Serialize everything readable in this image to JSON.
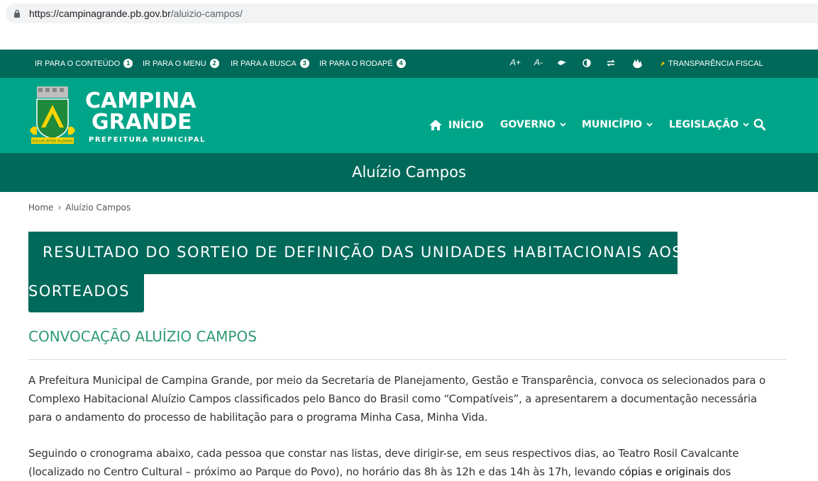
{
  "browser": {
    "url_host": "https://campinagrande.pb.gov.br",
    "url_path": "/aluizio-campos/"
  },
  "accessibility_bar": {
    "skip_links": [
      {
        "label": "IR PARA O CONTEÚDO",
        "number": "1"
      },
      {
        "label": "IR PARA O MENU",
        "number": "2"
      },
      {
        "label": "IR PARA A BUSCA",
        "number": "3"
      },
      {
        "label": "IR PARA O RODAPÉ",
        "number": "4"
      }
    ],
    "font_increase": "A+",
    "font_decrease": "A-",
    "transparency": "TRANSPARÊNCIA FISCAL"
  },
  "brand": {
    "line1": "CAMPINA",
    "line2": "GRANDE",
    "subtitle": "PREFEITURA MUNICIPAL"
  },
  "nav": {
    "home": "INÍCIO",
    "governo": "GOVERNO",
    "municipio": "MUNICÍPIO",
    "legislacao": "LEGISLAÇÃO"
  },
  "page": {
    "title": "Aluízio Campos",
    "breadcrumb_home": "Home",
    "breadcrumb_sep": "›",
    "breadcrumb_current": "Aluízio Campos",
    "banner_line1": "RESULTADO DO SORTEIO DE DEFINIÇÃO DAS UNIDADES HABITACIONAIS AOS",
    "banner_line2": "SORTEADOS",
    "subheading": "CONVOCAÇÃO ALUÍZIO CAMPOS",
    "paragraph1": [
      "A Prefeitura Municipal de Campina Grande, por meio da Secretaria de Planejamento, Gestão e Transparência, convoca os selecionados para o",
      "Complexo Habitacional Aluízio Campos classificados pelo Banco do Brasil como “Compatíveis”, a apresentarem a documentação necessária",
      "para o andamento do processo de habilitação para o programa Minha Casa, Minha Vida."
    ],
    "paragraph2": [
      "Seguindo o cronograma abaixo, cada pessoa que constar nas listas, deve dirigir-se, em seus respectivos dias, ao Teatro Rosil Cavalcante",
      "(localizado no Centro Cultural – próximo ao Parque do Povo), no horário das 8h às 12h e das 14h às 17h, levando "
    ],
    "paragraph2_strong": "cópias e originais",
    "paragraph2_tail": " dos"
  },
  "colors": {
    "dark_green": "#00695a",
    "header_green": "#00a589",
    "subheading_green": "#2f9b6f"
  }
}
